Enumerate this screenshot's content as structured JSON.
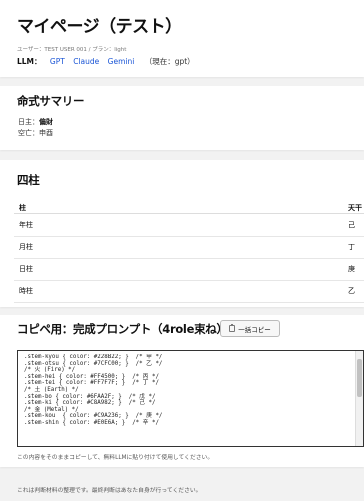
{
  "header": {
    "title": "マイページ（テスト）",
    "user_line": "ユーザー：TEST USER 001 / プラン：light",
    "llm_label": "LLM：",
    "llm_options": [
      "GPT",
      "Claude",
      "Gemini"
    ],
    "llm_current": "（現在：gpt）"
  },
  "meishiki": {
    "title": "命式サマリー",
    "nichishu_label": "日主：",
    "nichishu_value": "偏財",
    "kubou_label": "空亡：",
    "kubou_value": "申酉"
  },
  "pillars": {
    "title": "四柱",
    "headers": [
      "柱",
      "天干"
    ],
    "rows": [
      {
        "name": "年柱",
        "tenkan": "己"
      },
      {
        "name": "月柱",
        "tenkan": "丁"
      },
      {
        "name": "日柱",
        "tenkan": "庚"
      },
      {
        "name": "時柱",
        "tenkan": "乙"
      }
    ]
  },
  "prompt": {
    "title": "コピペ用：完成プロンプト（4role束ね）",
    "copy_button_label": "一括コピー",
    "code_lines": [
      ".stem-kyou { color: #228B22; }  /* 甲 */",
      ".stem-otsu { color: #7CFC00; }  /* 乙 */",
      "",
      "/* 火 (Fire) */",
      ".stem-hei { color: #FF4500; }  /* 丙 */",
      ".stem-tei { color: #FF7F7F; }  /* 丁 */",
      "",
      "/* 土 (Earth) */",
      ".stem-bo { color: #6FAA2F; }  /* 戊 */",
      ".stem-ki { color: #C8A982; }  /* 己 */",
      "",
      "/* 金 (Metal) */",
      ".stem-kou  { color: #C9A236; }  /* 庚 */",
      ".stem-shin { color: #E0E6A; }  /* 辛 */"
    ],
    "note": "この内容をそのままコピーして、無料LLMに貼り付けて使用してください。"
  },
  "footer": {
    "note": "これは判断材料の整理です。最終判断はあなた自身が行ってください。"
  },
  "colors": {
    "link": "#1a55d6",
    "background": "#f2f2f2",
    "card": "#ffffff"
  },
  "icons": {
    "copy": "clipboard-icon"
  }
}
